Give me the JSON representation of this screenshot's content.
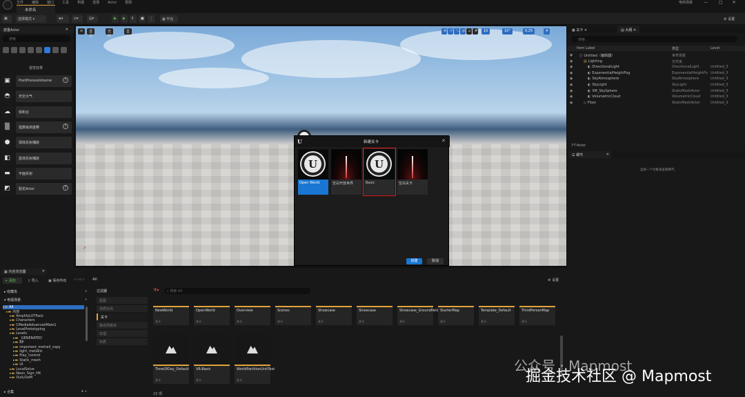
{
  "menu": {
    "items": [
      "文件",
      "编辑",
      "窗口",
      "工具",
      "构建",
      "选择",
      "Actor",
      "帮助"
    ],
    "right_label": "电商场景"
  },
  "window": {
    "level_tab": "未命名",
    "minimize": "—",
    "maximize": "□",
    "close": "✕"
  },
  "toolbar": {
    "mode": "选择模式",
    "platform": "平台",
    "settings": "设置"
  },
  "place_actors": {
    "title": "放置Actor",
    "search_placeholder": "搜索",
    "category_label": "视觉效果",
    "items": [
      {
        "label": "PostProcessVolume",
        "icon": "cube-icon",
        "help": true
      },
      {
        "label": "天空大气",
        "icon": "sky-icon",
        "help": false
      },
      {
        "label": "体积云",
        "icon": "cloud-icon",
        "help": false
      },
      {
        "label": "指数级高度雾",
        "icon": "fog-icon",
        "help": true
      },
      {
        "label": "球体反射捕获",
        "icon": "sphere-icon",
        "help": false
      },
      {
        "label": "盒体反射捕获",
        "icon": "box-icon",
        "help": false
      },
      {
        "label": "平面反射",
        "icon": "plane-icon",
        "help": false
      },
      {
        "label": "贴花Actor",
        "icon": "decal-icon",
        "help": true
      }
    ]
  },
  "viewport": {
    "left_buttons": [
      "≡",
      "透视",
      "光照",
      "显示"
    ],
    "right_values": [
      "10",
      "10°",
      "0.25",
      "4"
    ]
  },
  "outliner": {
    "tabs": [
      "关卡",
      "大纲"
    ],
    "search_placeholder": "搜索...",
    "columns": {
      "label": "Item Label",
      "type": "类型",
      "level": "Level"
    },
    "rows": [
      {
        "indent": 1,
        "label": "Untitled（编辑器）",
        "type": "世界场景",
        "level": ""
      },
      {
        "indent": 2,
        "label": "Lighting",
        "type": "文件夹",
        "level": ""
      },
      {
        "indent": 3,
        "label": "DirectionalLight",
        "type": "DirectionalLight",
        "level": "Untitled_3"
      },
      {
        "indent": 3,
        "label": "ExponentialHeightFog",
        "type": "ExponentialHeightFo",
        "level": "Untitled_3"
      },
      {
        "indent": 3,
        "label": "SkyAtmosphere",
        "type": "SkyAtmosphere",
        "level": "Untitled_3"
      },
      {
        "indent": 3,
        "label": "SkyLight",
        "type": "SkyLight",
        "level": "Untitled_3"
      },
      {
        "indent": 3,
        "label": "SM_SkySphere",
        "type": "StaticMeshActor",
        "level": "Untitled_3"
      },
      {
        "indent": 3,
        "label": "VolumetricCloud",
        "type": "VolumetricCloud",
        "level": "Untitled_3"
      },
      {
        "indent": 2,
        "label": "Floor",
        "type": "StaticMeshActor",
        "level": "Untitled_3"
      }
    ],
    "count": "7个Actor"
  },
  "details": {
    "tab": "细节",
    "empty_text": "选择一个对象来查看细节。"
  },
  "new_level_dialog": {
    "title": "新建关卡",
    "tiles": [
      {
        "label": "Open World",
        "kind": "logo",
        "selected": true,
        "highlighted": false
      },
      {
        "label": "空白开放世界",
        "kind": "grid",
        "selected": false,
        "highlighted": false
      },
      {
        "label": "Basic",
        "kind": "logo",
        "selected": false,
        "highlighted": true
      },
      {
        "label": "空白关卡",
        "kind": "grid",
        "selected": false,
        "highlighted": false
      }
    ],
    "create_label": "创建",
    "cancel_label": "取消"
  },
  "content_browser": {
    "tab": "内容浏览器",
    "add_label": "+ 添加",
    "import_label": "导入",
    "save_all_label": "保存所有",
    "path": "All",
    "settings_label": "设置",
    "favorites": "收藏夹",
    "project": "电视场景",
    "tree": [
      {
        "indent": 0,
        "label": "All",
        "selected": true
      },
      {
        "indent": 1,
        "label": "内容",
        "selected": false
      },
      {
        "indent": 2,
        "label": "AmplifyLUTPack",
        "selected": false
      },
      {
        "indent": 2,
        "label": "Characters",
        "selected": false
      },
      {
        "indent": 2,
        "label": "CMediaAdvancedMats1",
        "selected": false
      },
      {
        "indent": 2,
        "label": "LevelPrototyping",
        "selected": false
      },
      {
        "indent": 2,
        "label": "Levels",
        "selected": false
      },
      {
        "indent": 3,
        "label": "_GENERATED",
        "selected": false
      },
      {
        "indent": 3,
        "label": "BP",
        "selected": false
      },
      {
        "indent": 3,
        "label": "important_metrail_copy",
        "selected": false
      },
      {
        "indent": 3,
        "label": "light_metallic",
        "selected": false
      },
      {
        "indent": 3,
        "label": "Play_control",
        "selected": false
      },
      {
        "indent": 3,
        "label": "Static_mesh",
        "selected": false
      },
      {
        "indent": 3,
        "label": "UI",
        "selected": false
      },
      {
        "indent": 2,
        "label": "LocalSolve",
        "selected": false
      },
      {
        "indent": 2,
        "label": "Neon_Sign_HK",
        "selected": false
      },
      {
        "indent": 2,
        "label": "OutLineM",
        "selected": false
      }
    ],
    "collections_label": "合集",
    "filters_title": "过滤器",
    "filters": [
      "蓝图",
      "材质实例",
      "关卡",
      "静态网格体",
      "纹理",
      "材质"
    ],
    "active_filter": "关卡",
    "search_placeholder": "搜索 All",
    "assets_row1": [
      "NewWorld",
      "OpenWorld",
      "Overview",
      "Scenes",
      "Showcase",
      "Showcase",
      "Showcase_Groundfield",
      "StarterMap",
      "Template_Default",
      "ThirdPersonMap"
    ],
    "assets_row2": [
      "TimeOfDay_Default",
      "VR-Basic",
      "WorldPartitionUnitTest"
    ],
    "asset_type": "关卡",
    "count": "23 项"
  },
  "watermark": {
    "main": "掘金技术社区 @ Mapmost",
    "sub": "公众号 · Mapmost"
  }
}
